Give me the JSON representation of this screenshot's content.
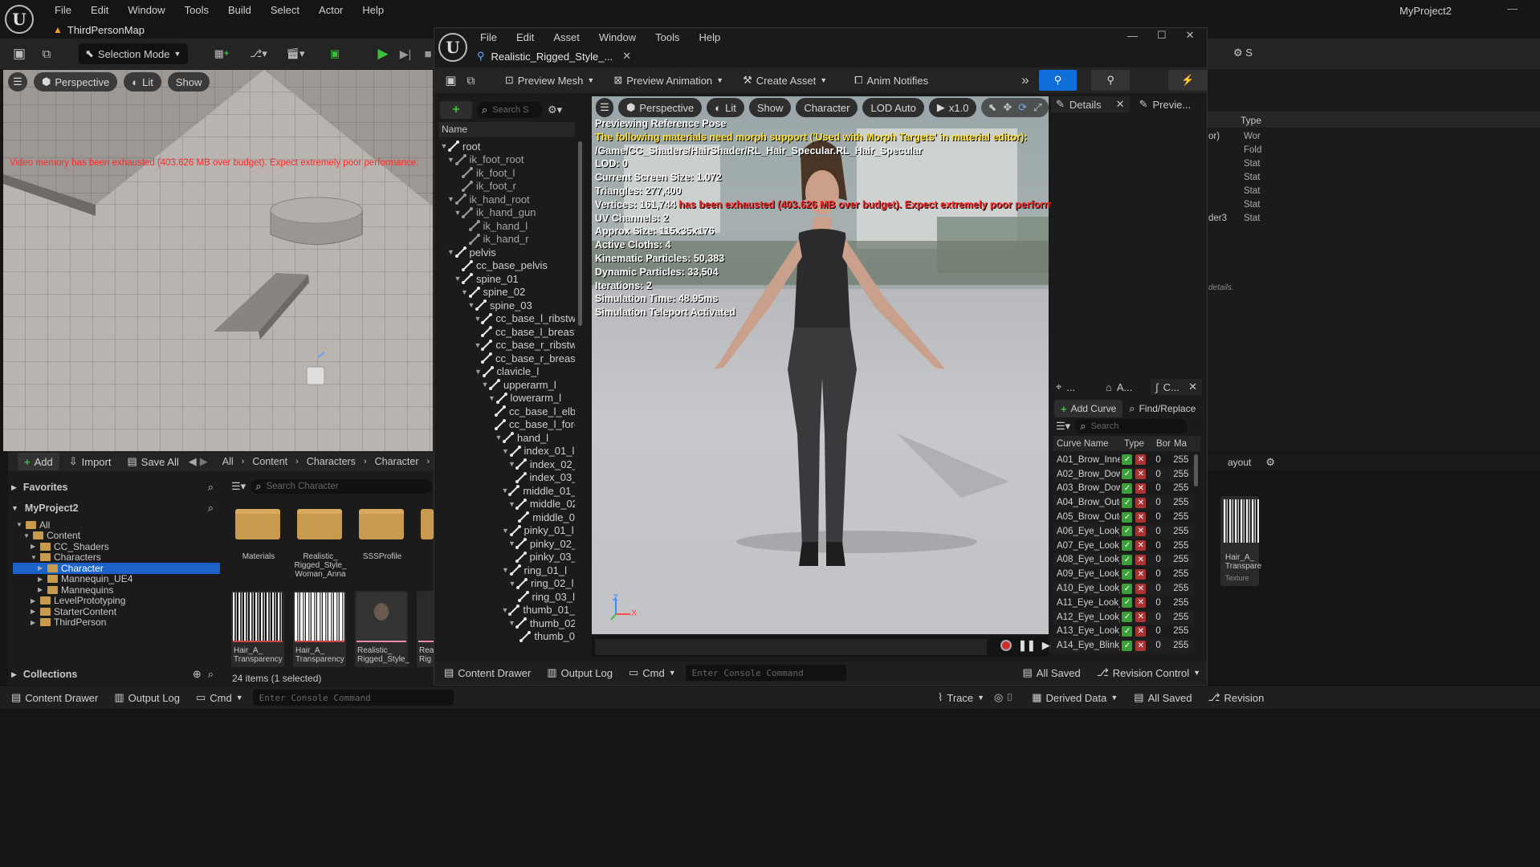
{
  "main_window": {
    "project_name": "MyProject2",
    "menu": [
      "File",
      "Edit",
      "Window",
      "Tools",
      "Build",
      "Select",
      "Actor",
      "Help"
    ],
    "map_tab": "ThirdPersonMap",
    "selection_mode": "Selection Mode",
    "viewport": {
      "perspective": "Perspective",
      "lit": "Lit",
      "show": "Show",
      "warning": "Video memory has been exhausted (403.626 MB over budget). Expect extremely poor performance."
    },
    "content_browser": {
      "add": "Add",
      "import": "Import",
      "save_all": "Save All",
      "path": [
        "All",
        "Content",
        "Characters",
        "Character"
      ],
      "favorites": "Favorites",
      "project": "MyProject2",
      "search_placeholder": "Search Character",
      "tree": [
        {
          "label": "All",
          "depth": 0,
          "open": true
        },
        {
          "label": "Content",
          "depth": 1,
          "open": true
        },
        {
          "label": "CC_Shaders",
          "depth": 2,
          "open": false
        },
        {
          "label": "Characters",
          "depth": 2,
          "open": true
        },
        {
          "label": "Character",
          "depth": 3,
          "open": false,
          "selected": true
        },
        {
          "label": "Mannequin_UE4",
          "depth": 3,
          "open": false
        },
        {
          "label": "Mannequins",
          "depth": 3,
          "open": false
        },
        {
          "label": "LevelPrototyping",
          "depth": 2,
          "open": false
        },
        {
          "label": "StarterContent",
          "depth": 2,
          "open": false
        },
        {
          "label": "ThirdPerson",
          "depth": 2,
          "open": false
        }
      ],
      "folders": [
        {
          "label": "Materials"
        },
        {
          "label": "Realistic_\nRigged_Style_\nWoman_Anna"
        },
        {
          "label": "SSSProfile"
        }
      ],
      "assets": [
        {
          "label": "Hair_A_\nTransparency"
        },
        {
          "label": "Hair_A_\nTransparency"
        },
        {
          "label": "Realistic_\nRigged_Style_"
        },
        {
          "label": "Rea\nRig"
        }
      ],
      "collections": "Collections",
      "status": "24 items (1 selected)"
    },
    "status_bar": {
      "content_drawer": "Content Drawer",
      "output_log": "Output Log",
      "cmd": "Cmd",
      "console_placeholder": "Enter Console Command",
      "trace": "Trace",
      "derived_data": "Derived Data",
      "all_saved": "All Saved",
      "revision": "Revision"
    },
    "right_peek": {
      "type_header": "Type",
      "types": [
        "Wor",
        "Fold",
        "Stat",
        "Stat",
        "Stat",
        "Stat",
        "Stat"
      ],
      "names": [
        "or)",
        "",
        "",
        "",
        "",
        "",
        "der3"
      ],
      "details_hint": "details.",
      "layout": "ayout",
      "peek_asset": "Hair_A_\nTranspare",
      "peek_kind": "Texture",
      "s_label": "S"
    }
  },
  "editor": {
    "menu": [
      "File",
      "Edit",
      "Asset",
      "Window",
      "Tools",
      "Help"
    ],
    "tab": "Realistic_Rigged_Style_...",
    "toolbar": {
      "preview_mesh": "Preview Mesh",
      "preview_animation": "Preview Animation",
      "create_asset": "Create Asset",
      "anim_notifies": "Anim Notifies"
    },
    "skeleton": {
      "search_placeholder": "Search S",
      "header": "Name",
      "bones": [
        {
          "label": "root",
          "depth": 0,
          "tri": true
        },
        {
          "label": "ik_foot_root",
          "depth": 1,
          "tri": true,
          "dim": true
        },
        {
          "label": "ik_foot_l",
          "depth": 2,
          "dim": true
        },
        {
          "label": "ik_foot_r",
          "depth": 2,
          "dim": true
        },
        {
          "label": "ik_hand_root",
          "depth": 1,
          "tri": true,
          "dim": true
        },
        {
          "label": "ik_hand_gun",
          "depth": 2,
          "tri": true,
          "dim": true
        },
        {
          "label": "ik_hand_l",
          "depth": 3,
          "dim": true
        },
        {
          "label": "ik_hand_r",
          "depth": 3,
          "dim": true
        },
        {
          "label": "pelvis",
          "depth": 1,
          "tri": true
        },
        {
          "label": "cc_base_pelvis",
          "depth": 2
        },
        {
          "label": "spine_01",
          "depth": 2,
          "tri": true
        },
        {
          "label": "spine_02",
          "depth": 3,
          "tri": true
        },
        {
          "label": "spine_03",
          "depth": 4,
          "tri": true
        },
        {
          "label": "cc_base_l_ribstwist",
          "depth": 5,
          "tri": true
        },
        {
          "label": "cc_base_l_breast",
          "depth": 6
        },
        {
          "label": "cc_base_r_ribstwist",
          "depth": 5,
          "tri": true
        },
        {
          "label": "cc_base_r_breast",
          "depth": 6
        },
        {
          "label": "clavicle_l",
          "depth": 5,
          "tri": true
        },
        {
          "label": "upperarm_l",
          "depth": 6,
          "tri": true
        },
        {
          "label": "lowerarm_l",
          "depth": 7,
          "tri": true
        },
        {
          "label": "cc_base_l_elbo",
          "depth": 8
        },
        {
          "label": "cc_base_l_fore",
          "depth": 8
        },
        {
          "label": "hand_l",
          "depth": 8,
          "tri": true
        },
        {
          "label": "index_01_l",
          "depth": 9,
          "tri": true
        },
        {
          "label": "index_02_l",
          "depth": 10,
          "tri": true
        },
        {
          "label": "index_03_",
          "depth": 11
        },
        {
          "label": "middle_01_l",
          "depth": 9,
          "tri": true
        },
        {
          "label": "middle_02_",
          "depth": 10,
          "tri": true
        },
        {
          "label": "middle_0",
          "depth": 11
        },
        {
          "label": "pinky_01_l",
          "depth": 9,
          "tri": true
        },
        {
          "label": "pinky_02_l",
          "depth": 10,
          "tri": true
        },
        {
          "label": "pinky_03_",
          "depth": 11
        },
        {
          "label": "ring_01_l",
          "depth": 9,
          "tri": true
        },
        {
          "label": "ring_02_l",
          "depth": 10,
          "tri": true
        },
        {
          "label": "ring_03_l",
          "depth": 11
        },
        {
          "label": "thumb_01_l",
          "depth": 9,
          "tri": true
        },
        {
          "label": "thumb_02_",
          "depth": 10,
          "tri": true
        },
        {
          "label": "thumb_0",
          "depth": 11
        }
      ]
    },
    "viewport": {
      "perspective": "Perspective",
      "lit": "Lit",
      "show": "Show",
      "character": "Character",
      "lod": "LOD Auto",
      "speed": "x1.0",
      "stats": [
        {
          "text": "Previewing Reference Pose",
          "color": "#ffffff"
        },
        {
          "text": "The following materials need morph support ('Used with Morph Targets' in material editor):",
          "color": "#ffe23a"
        },
        {
          "text": "/Game/CC_Shaders/HairShader/RL_Hair_Specular.RL_Hair_Specular",
          "color": "#ffffff"
        },
        {
          "text": "LOD: 0",
          "color": "#ffffff"
        },
        {
          "text": "Current Screen Size: 1.072",
          "color": "#ffffff"
        },
        {
          "text": "Triangles: 277,400",
          "color": "#ffffff"
        },
        {
          "text": "Vertices: 161,744",
          "color": "#ffffff",
          "tail": " has been exhausted (403.626 MB over budget). Expect extremely poor performance.",
          "tail_color": "#ff3030"
        },
        {
          "text": "UV Channels: 2",
          "color": "#ffffff"
        },
        {
          "text": "Approx Size: 115x35x176",
          "color": "#ffffff"
        },
        {
          "text": "Active Cloths: 4",
          "color": "#ffffff"
        },
        {
          "text": "Kinematic Particles: 50,383",
          "color": "#ffffff"
        },
        {
          "text": "Dynamic Particles: 33,504",
          "color": "#ffffff"
        },
        {
          "text": "Iterations: 2",
          "color": "#ffffff"
        },
        {
          "text": "Simulation Time: 48.95ms",
          "color": "#ffffff"
        },
        {
          "text": "Simulation Teleport Activated",
          "color": "#ffffff"
        }
      ],
      "axis_z": "Z",
      "axis_x": "X"
    },
    "details": {
      "tab_details": "Details",
      "tab_preview": "Previe..."
    },
    "curves": {
      "tabs": [
        "...",
        "A...",
        "C..."
      ],
      "add_curve": "Add Curve",
      "find_replace": "Find/Replace",
      "search_placeholder": "Search",
      "headers": {
        "name": "Curve Name",
        "type": "Type",
        "bone": "Bor",
        "max": "Ma"
      },
      "rows": [
        {
          "name": "A01_Brow_Inner_U",
          "b": "0",
          "m": "255"
        },
        {
          "name": "A02_Brow_Down_L",
          "b": "0",
          "m": "255"
        },
        {
          "name": "A03_Brow_Down_R",
          "b": "0",
          "m": "255"
        },
        {
          "name": "A04_Brow_Outer_U",
          "b": "0",
          "m": "255"
        },
        {
          "name": "A05_Brow_Outer_U",
          "b": "0",
          "m": "255"
        },
        {
          "name": "A06_Eye_Look_Up_",
          "b": "0",
          "m": "255"
        },
        {
          "name": "A07_Eye_Look_Up_",
          "b": "0",
          "m": "255"
        },
        {
          "name": "A08_Eye_Look_Dov",
          "b": "0",
          "m": "255"
        },
        {
          "name": "A09_Eye_Look_Dov",
          "b": "0",
          "m": "255"
        },
        {
          "name": "A10_Eye_Look_Ou",
          "b": "0",
          "m": "255"
        },
        {
          "name": "A11_Eye_Look_In_",
          "b": "0",
          "m": "255"
        },
        {
          "name": "A12_Eye_Look_In_",
          "b": "0",
          "m": "255"
        },
        {
          "name": "A13_Eye_Look_Ou",
          "b": "0",
          "m": "255"
        },
        {
          "name": "A14_Eye_Blink_Le",
          "b": "0",
          "m": "255"
        }
      ]
    },
    "status_bar": {
      "content_drawer": "Content Drawer",
      "output_log": "Output Log",
      "cmd": "Cmd",
      "console_placeholder": "Enter Console Command",
      "all_saved": "All Saved",
      "revision_control": "Revision Control"
    }
  },
  "colors": {
    "accent_blue": "#0e6fd8",
    "play_green": "#3cc13c",
    "selection": "#1c62c9",
    "warning_red": "#ff2a2a"
  }
}
